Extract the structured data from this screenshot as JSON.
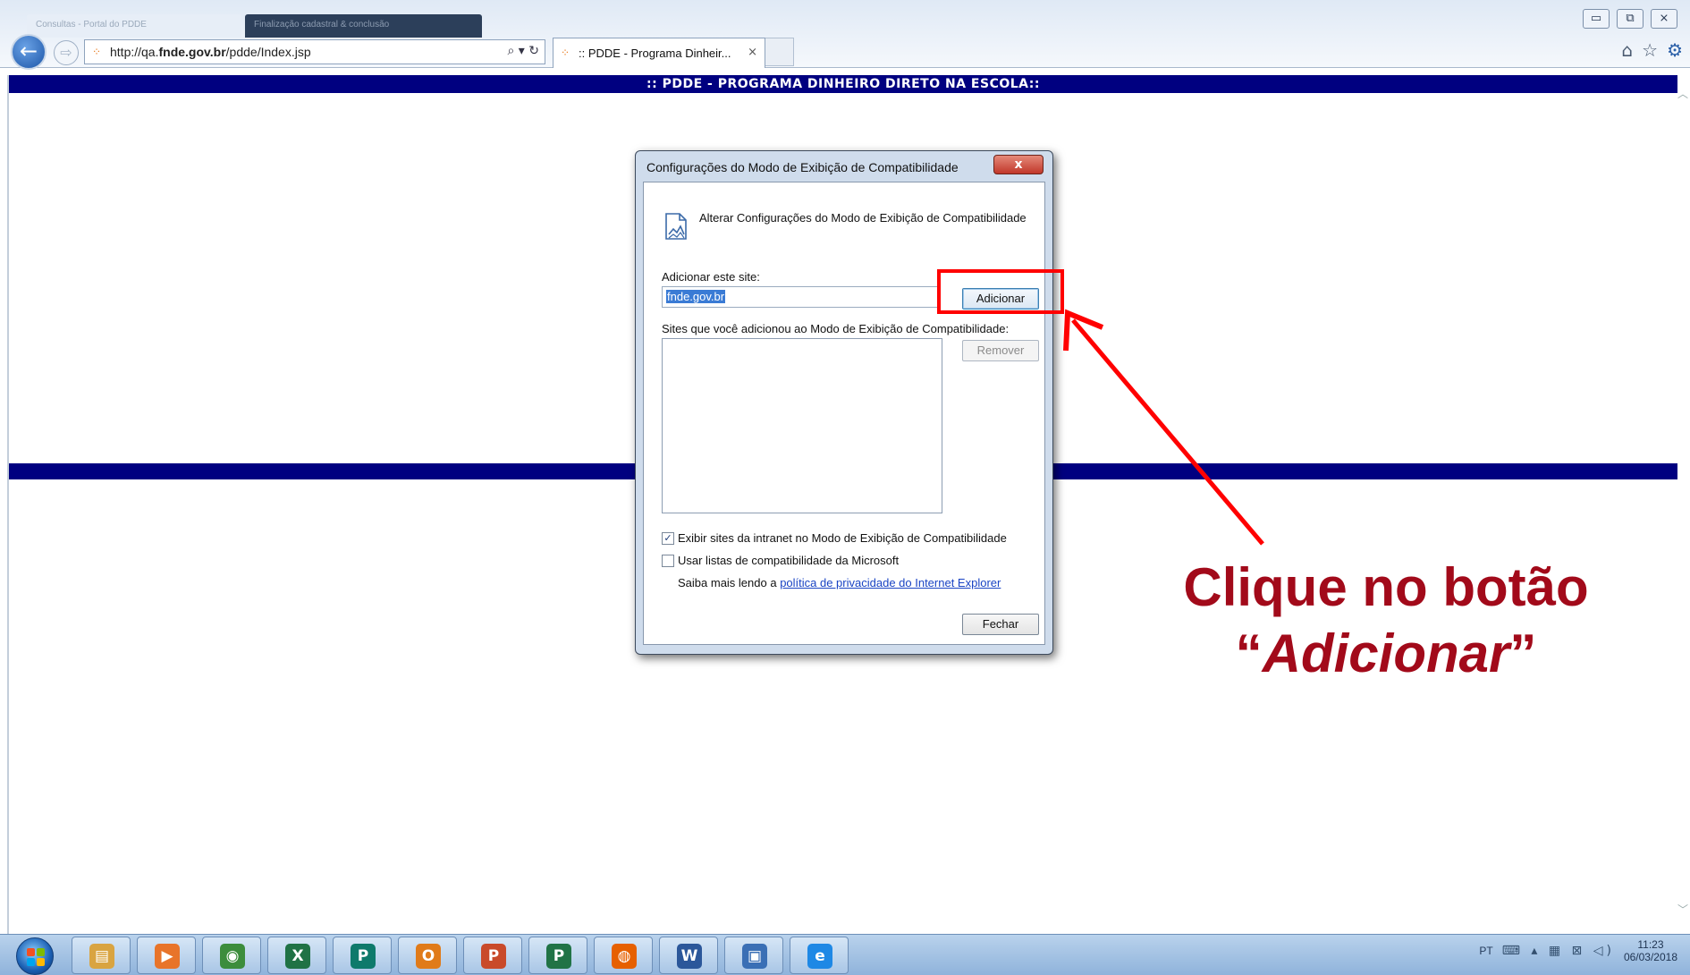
{
  "browser": {
    "ghost_tabs": [
      "Consultas - Portal do PDDE",
      "Finalização cadastral & conclusão"
    ],
    "address_prefix": "http://qa.",
    "address_host": "fnde.gov.br",
    "address_path": "/pdde/Index.jsp",
    "address_tools": "⌕ ▾ ↻",
    "tab_title": ":: PDDE - Programa Dinheir...",
    "tab_close": "×",
    "back_glyph": "←",
    "forward_glyph": "⇨",
    "win_minimize": "▭",
    "win_restore": "⧉",
    "win_close": "⨯",
    "home_icon": "⌂",
    "favorites_icon": "☆",
    "tools_icon": "⚙"
  },
  "page": {
    "banner": ":: PDDE - PROGRAMA DINHEIRO DIRETO NA ESCOLA::"
  },
  "dialog": {
    "title": "Configurações do Modo de Exibição de Compatibilidade",
    "close_glyph": "x",
    "heading": "Alterar Configurações do Modo de Exibição de Compatibilidade",
    "add_label": "Adicionar este site:",
    "add_value": "fnde.gov.br",
    "add_button": "Adicionar",
    "sites_label": "Sites que você adicionou ao Modo de Exibição de Compatibilidade:",
    "remove_button": "Remover",
    "checkbox_1": {
      "label": "Exibir sites da intranet no Modo de Exibição de Compatibilidade",
      "checked": true,
      "mark": "✓"
    },
    "checkbox_2": {
      "label": "Usar listas de compatibilidade da Microsoft",
      "checked": false,
      "mark": ""
    },
    "privacy_prefix": "Saiba mais lendo a ",
    "privacy_link": "política de privacidade do Internet Explorer",
    "close_button": "Fechar"
  },
  "annotation": {
    "line1": "Clique no botão",
    "line2_open": "“",
    "line2_word": "Adicionar",
    "line2_close": "”",
    "color": "#a20a1a",
    "highlight_color": "#ff0000"
  },
  "taskbar": {
    "apps": [
      {
        "name": "explorer-icon",
        "glyph": "▤",
        "color": "#d9a441"
      },
      {
        "name": "media-player-icon",
        "glyph": "▶",
        "color": "#e8742a"
      },
      {
        "name": "chrome-icon",
        "glyph": "◉",
        "color": "#3c8d3c"
      },
      {
        "name": "excel-icon",
        "glyph": "X",
        "color": "#207245"
      },
      {
        "name": "publisher-icon",
        "glyph": "P",
        "color": "#0e7a6b"
      },
      {
        "name": "outlook-icon",
        "glyph": "O",
        "color": "#e07b1a"
      },
      {
        "name": "powerpoint-icon",
        "glyph": "P",
        "color": "#c94a2a"
      },
      {
        "name": "project-icon",
        "glyph": "P",
        "color": "#217346"
      },
      {
        "name": "firefox-icon",
        "glyph": "◍",
        "color": "#e66000"
      },
      {
        "name": "word-icon",
        "glyph": "W",
        "color": "#2b579a"
      },
      {
        "name": "remote-desktop-icon",
        "glyph": "▣",
        "color": "#3a6fb5"
      },
      {
        "name": "internet-explorer-icon",
        "glyph": "e",
        "color": "#1e88e5"
      }
    ],
    "language": "PT",
    "tray_icons": "⌨ ▴ ▦ ⊠ ◁)",
    "time": "11:23",
    "date": "06/03/2018"
  }
}
